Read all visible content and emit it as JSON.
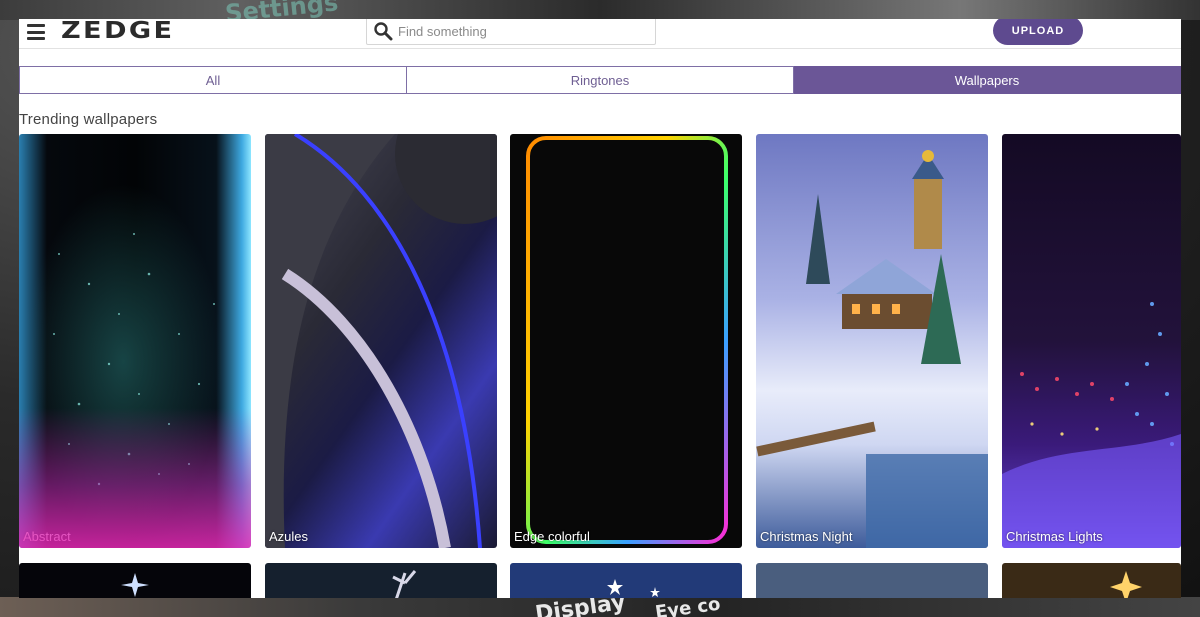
{
  "header": {
    "logo_text": "ZEDGE",
    "search_placeholder": "Find something",
    "upload_label": "UPLOAD"
  },
  "tabs": [
    {
      "label": "All",
      "active": false
    },
    {
      "label": "Ringtones",
      "active": false
    },
    {
      "label": "Wallpapers",
      "active": true
    }
  ],
  "section": {
    "title": "Trending wallpapers"
  },
  "wallpapers": [
    {
      "title": "Abstract"
    },
    {
      "title": "Azules"
    },
    {
      "title": "Edge colorful"
    },
    {
      "title": "Christmas Night"
    },
    {
      "title": "Christmas Lights"
    }
  ],
  "background": {
    "top_text": "Settings",
    "bottom_text_a": "Display",
    "bottom_text_b": "Eye co"
  },
  "colors": {
    "accent": "#6b5697",
    "upload_button": "#5e4a8f"
  },
  "icons": {
    "menu": "hamburger-menu-icon",
    "search": "search-icon"
  }
}
